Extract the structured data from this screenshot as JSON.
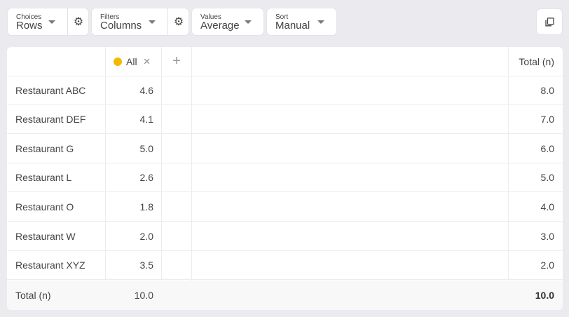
{
  "toolbar": {
    "choices": {
      "caption": "Choices",
      "value": "Rows"
    },
    "filters": {
      "caption": "Filters",
      "value": "Columns"
    },
    "values": {
      "caption": "Values",
      "value": "Average"
    },
    "sort": {
      "caption": "Sort",
      "value": "Manual"
    }
  },
  "table": {
    "header": {
      "segment_label": "All",
      "segment_dot_color": "#f5b800",
      "total_label": "Total (n)"
    },
    "rows": [
      {
        "label": "Restaurant ABC",
        "value": "4.6",
        "total": "8.0"
      },
      {
        "label": "Restaurant DEF",
        "value": "4.1",
        "total": "7.0"
      },
      {
        "label": "Restaurant G",
        "value": "5.0",
        "total": "6.0"
      },
      {
        "label": "Restaurant L",
        "value": "2.6",
        "total": "5.0"
      },
      {
        "label": "Restaurant O",
        "value": "1.8",
        "total": "4.0"
      },
      {
        "label": "Restaurant W",
        "value": "2.0",
        "total": "3.0"
      },
      {
        "label": "Restaurant XYZ",
        "value": "3.5",
        "total": "2.0"
      }
    ],
    "footer": {
      "label": "Total (n)",
      "value": "10.0",
      "total": "10.0"
    }
  }
}
